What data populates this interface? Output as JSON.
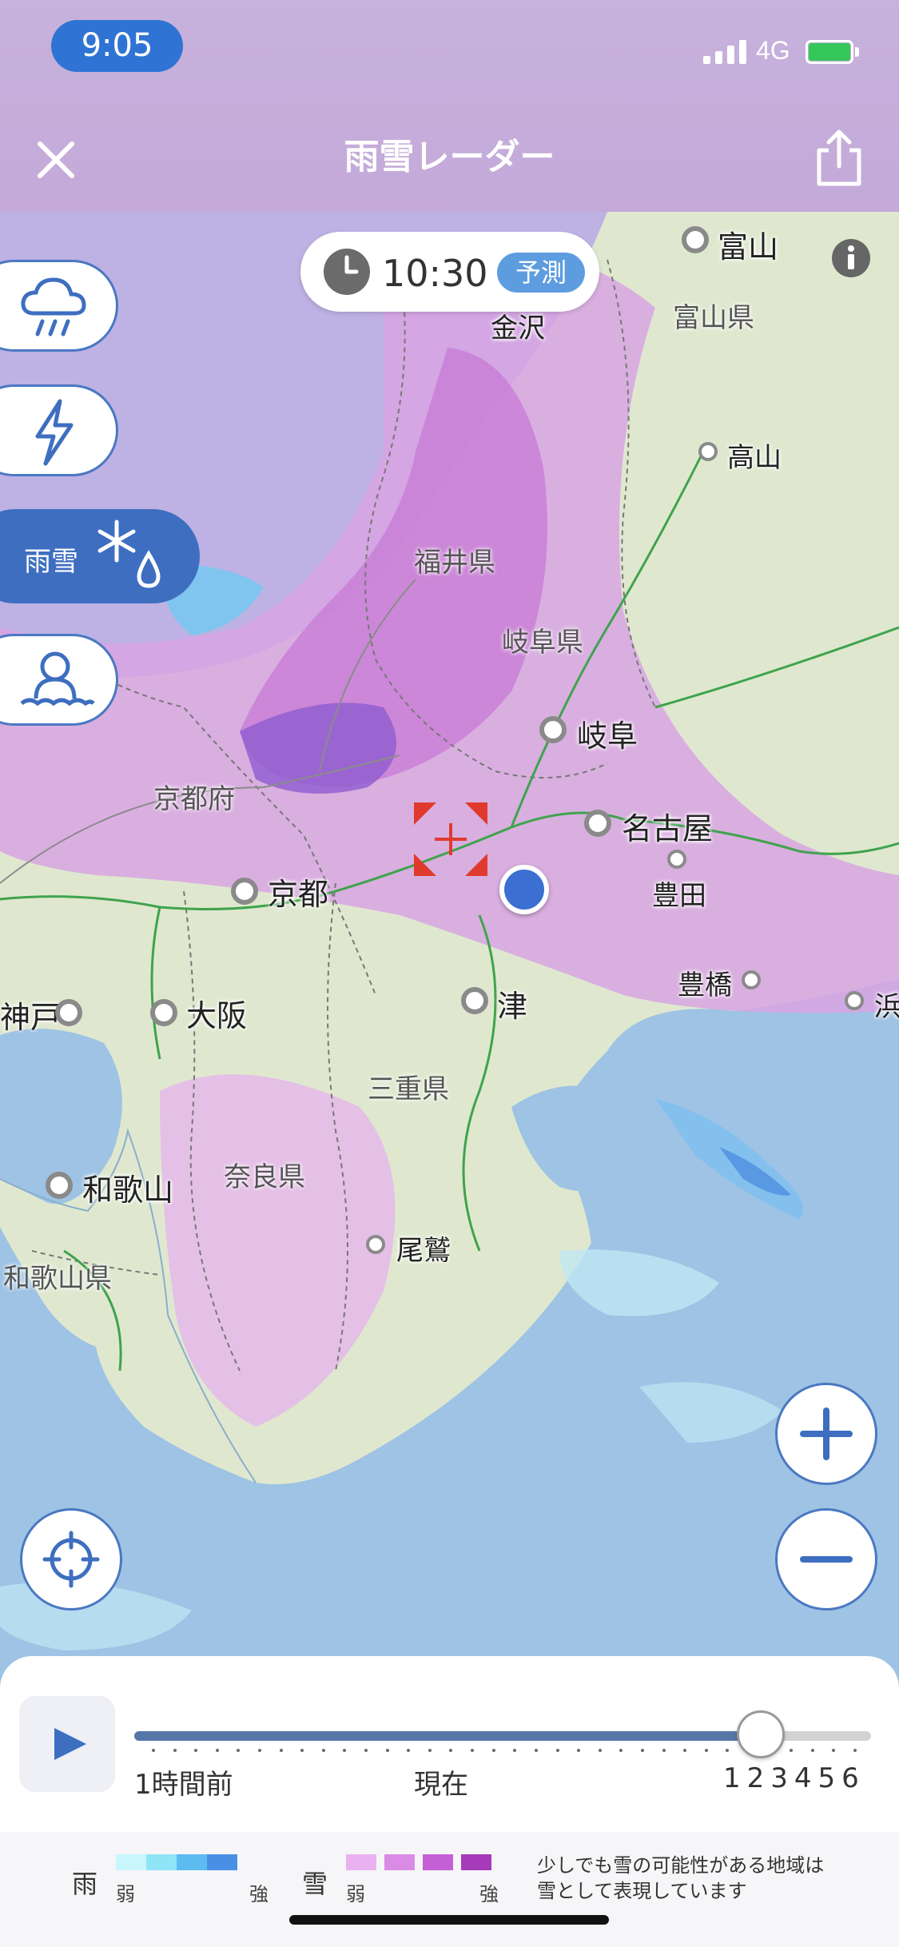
{
  "status_bar": {
    "time": "9:05",
    "network": "4G"
  },
  "header": {
    "title": "雨雪レーダー",
    "close_icon": "close-icon",
    "share_icon": "share-icon"
  },
  "time_chip": {
    "time": "10:30",
    "badge": "予測"
  },
  "layers": [
    {
      "name": "rain",
      "icon": "cloud-rain-icon"
    },
    {
      "name": "lightning",
      "icon": "lightning-icon"
    },
    {
      "name": "snow-rain",
      "label": "雨雪",
      "icon": "snowflake-drop-icon",
      "selected": true
    },
    {
      "name": "snowman",
      "icon": "snowman-icon"
    }
  ],
  "map": {
    "cities": {
      "toyama": "富山",
      "kanazawa": "金沢",
      "takayama": "高山",
      "gifu": "岐阜",
      "nagoya": "名古屋",
      "toyota": "豊田",
      "toyohashi": "豊橋",
      "hama": "浜",
      "kyoto": "京都",
      "osaka": "大阪",
      "kobe": "神戸",
      "tsu": "津",
      "wakayama": "和歌山",
      "owase": "尾鷲"
    },
    "prefectures": {
      "toyama_pref": "富山県",
      "fukui_pref": "福井県",
      "gifu_pref": "岐阜県",
      "kyoto_pref": "京都府",
      "mie_pref": "三重県",
      "nara_pref": "奈良県",
      "wakayama_pref": "和歌山県"
    }
  },
  "timeline": {
    "past_label": "1時間前",
    "now_label": "現在",
    "future_label": "123456",
    "position": 0.85
  },
  "legend": {
    "rain_label": "雨",
    "snow_label": "雪",
    "weak": "弱",
    "strong": "強",
    "rain_colors": [
      "#c8f6fb",
      "#8fe4f6",
      "#5cbcf0",
      "#4a8fe6"
    ],
    "snow_colors": [
      "#e9b1ef",
      "#d98be6",
      "#c55fd6",
      "#a53bb8"
    ],
    "note_line1": "少しでも雪の可能性がある地域は",
    "note_line2": "雪として表現しています"
  },
  "colors": {
    "accent": "#3e6ec0",
    "time_pill": "#2f74d4",
    "forecast": "#5d9cdf"
  }
}
